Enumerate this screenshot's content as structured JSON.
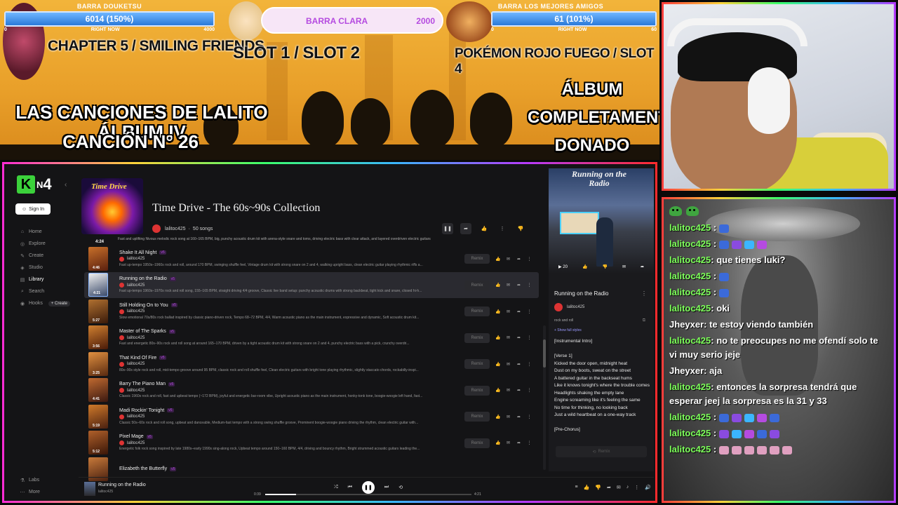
{
  "banner": {
    "bar1": {
      "title": "BARRA DOUKETSU",
      "value": "6014 (150%)",
      "left": "0",
      "center": "RIGHT NOW",
      "right": "4000",
      "progress": 1.0
    },
    "bar2": {
      "title": "BARRA LOS MEJORES AMIGOS",
      "value": "61 (101%)",
      "left": "0",
      "center": "RIGHT NOW",
      "right": "60",
      "progress": 1.0
    },
    "clara": {
      "label": "BARRA CLARA",
      "value": "2000"
    },
    "heading1": "CHAPTER 5 / SMILING FRIENDS",
    "heading2": "SLOT 1 / SLOT 2",
    "heading3": "POKÉMON ROJO FUEGO / SLOT 4",
    "title_line1": "LAS CANCIONES DE LALITO ÁLBUM IV",
    "title_line2": "CANCIÓN N° 26",
    "donated_line1": "ÁLBUM",
    "donated_line2": "COMPLETAMENTE",
    "donated_line3": "DONADO"
  },
  "app": {
    "logo_k": "K",
    "logo_n": "N",
    "logo_4": "4",
    "collapse_icon": "chevron-left-icon",
    "signin_label": "Sign In",
    "nav": [
      {
        "label": "Home",
        "icon": "home-icon",
        "glyph": "⌂"
      },
      {
        "label": "Explore",
        "icon": "explore-icon",
        "glyph": "◎"
      },
      {
        "label": "Create",
        "icon": "create-icon",
        "glyph": "✎"
      },
      {
        "label": "Studio",
        "icon": "studio-icon",
        "glyph": "◈"
      },
      {
        "label": "Library",
        "icon": "library-icon",
        "glyph": "▤"
      },
      {
        "label": "Search",
        "icon": "search-icon",
        "glyph": "⌕"
      },
      {
        "label": "Hooks",
        "icon": "hooks-icon",
        "glyph": "◉"
      }
    ],
    "create_pill": "+ Create",
    "nav_bottom": [
      {
        "label": "Labs",
        "glyph": "⚗"
      },
      {
        "label": "More",
        "glyph": "⋯"
      }
    ],
    "album": {
      "art_title": "Time Drive",
      "title": "Time Drive - The 60s~90s Collection",
      "user": "lalitoc425",
      "count": "50 songs",
      "first_time": "4:24",
      "first_desc": "Fast and uplifting Nivous melodic rock song at 160–165 BPM, big, punchy acoustic drum kit with arena-style snare and toms, driving electric bass with clear attack, and layered overdriven electric guitars"
    },
    "tracks": [
      {
        "title": "Shake It All Night",
        "ver": "v5",
        "user": "lalitoc425",
        "dur": "4:46",
        "desc": "Fast up-tempo 1950s–1960s rock and roll, around 170 BPM, swinging shuffle feel, Vintage drum kit with strong snare on 2 and 4, walking upright bass, clean electric guitar playing rhythmic riffs a..."
      },
      {
        "title": "Running on the Radio",
        "ver": "v5",
        "user": "lalitoc425",
        "dur": "4:21",
        "desc": "Fast up-tempo 1960s–1970s rock and roll song, 155–165 BPM, straight driving 4/4 groove, Classic live band setup: punchy acoustic drums with strong backbeat, tight kick and snare, closed hi-h..."
      },
      {
        "title": "Still Holding On to You",
        "ver": "v5",
        "user": "lalitoc425",
        "dur": "5:27",
        "desc": "Slow emotional 70s/80s rock ballad inspired by classic piano-driven rock, Tempo 68–72 BPM, 4/4, Warm acoustic piano as the main instrument, expressive and dynamic, Soft acoustic drum kit..."
      },
      {
        "title": "Master of The Sparks",
        "ver": "v5",
        "user": "lalitoc425",
        "dur": "3:56",
        "desc": "Fast and energetic 80s–90s rock and roll song at around 165–170 BPM, driven by a tight acoustic drum kit with strong snare on 2 and 4, punchy electric bass with a pick, crunchy overdri..."
      },
      {
        "title": "That Kind Of Fire",
        "ver": "v5",
        "user": "lalitoc425",
        "dur": "3:25",
        "desc": "80s–90s style rock and roll, mid-tempo groove around 95 BPM, classic rock and roll shuffle feel, Clean electric guitars with bright tone playing rhythmic, slightly staccato chords, rockabilly-inspi..."
      },
      {
        "title": "Barry The Piano Man",
        "ver": "v5",
        "user": "lalitoc425",
        "dur": "4:41",
        "desc": "Classic 1960s rock and roll, fast and upbeat tempo (~172 BPM), joyful and energetic bar-room vibe, Upright acoustic piano as the main instrument, honky-tonk tone, boogie-woogie left hand, fast..."
      },
      {
        "title": "Madi Rockin' Tonight",
        "ver": "v5",
        "user": "lalitoc425",
        "dur": "5:19",
        "desc": "Classic 50s–60s rock and roll song, upbeat and danceable, Medium-fast tempo with a strong swing shuffle groove, Prominent boogie-woogie piano driving the rhythm, clean electric guitar with..."
      },
      {
        "title": "Pixel Mage",
        "ver": "v5",
        "user": "lalitoc425",
        "dur": "5:12",
        "desc": "Energetic folk rock song inspired by late 1980s–early 1990s sing-along rock, Upbeat tempo around 150–160 BPM, 4/4, driving and bouncy rhythm, Bright strummed acoustic guitars leading the..."
      },
      {
        "title": "Elizabeth the Butterfly",
        "ver": "v5",
        "user": "",
        "dur": "",
        "desc": ""
      }
    ],
    "remix_label": "Remix",
    "right_panel": {
      "art_title": "Running on the Radio",
      "art_count": "20",
      "title": "Running on the Radio",
      "user": "lalitoc425",
      "style": "rock and roll",
      "show_full": "+ Show full styles",
      "lyrics": "[Instrumental Intro]\n\n[Verse 1]\nKicked the door open, midnight heat\nDust on my boots, sweat on the street\nA battered guitar in the backseat hums\nLike it knows tonight's where the trouble comes\nHeadlights shaking the empty lane\nEngine screaming like it's feeling the same\nNo time for thinking, no looking back\nJust a wild heartbeat on a one-way track\n\n[Pre-Chorus]",
      "remix_label": "Remix"
    },
    "player": {
      "title": "Running on the Radio",
      "user": "lalitoc425",
      "elapsed": "0:39",
      "total": "4:21",
      "progress": 0.15
    }
  },
  "chat": {
    "messages": [
      {
        "user": "lalitoc425",
        "text": "",
        "colors": [
          "#3b6ad9"
        ]
      },
      {
        "user": "lalitoc425",
        "text": "",
        "colors": [
          "#3b6ad9",
          "#8a4be0",
          "#3bb6ff",
          "#b54be0"
        ]
      },
      {
        "user": "lalitoc425",
        "text": ": que tienes luki?",
        "colors": []
      },
      {
        "user": "lalitoc425",
        "text": "",
        "colors": [
          "#3b6ad9"
        ]
      },
      {
        "user": "lalitoc425",
        "text": "",
        "colors": [
          "#3b6ad9"
        ]
      },
      {
        "user": "lalitoc425",
        "text": ": oki",
        "colors": []
      },
      {
        "user": "Jheyxer",
        "text": ": te estoy viendo también",
        "colors": [],
        "alt": true
      },
      {
        "user": "lalitoc425",
        "text": ": no te preocupes no me ofendí solo te vi muy serio jeje",
        "colors": []
      },
      {
        "user": "Jheyxer",
        "text": ": aja",
        "colors": [],
        "alt": true
      },
      {
        "user": "lalitoc425",
        "text": ": entonces la sorpresa tendrá que esperar jeej la sorpresa es la 31 y 33",
        "colors": []
      },
      {
        "user": "lalitoc425",
        "text": "",
        "colors": [
          "#3b6ad9",
          "#8a4be0",
          "#3bb6ff",
          "#b54be0",
          "#3b6ad9"
        ]
      },
      {
        "user": "lalitoc425",
        "text": "",
        "colors": [
          "#8a4be0",
          "#3bb6ff",
          "#b54be0",
          "#3b6ad9",
          "#8a4be0"
        ]
      },
      {
        "user": "lalitoc425",
        "text": "",
        "colors": [
          "#e0a0c0",
          "#e0a0c0",
          "#e0a0c0",
          "#e0a0c0",
          "#e0a0c0",
          "#e0a0c0"
        ]
      }
    ]
  }
}
